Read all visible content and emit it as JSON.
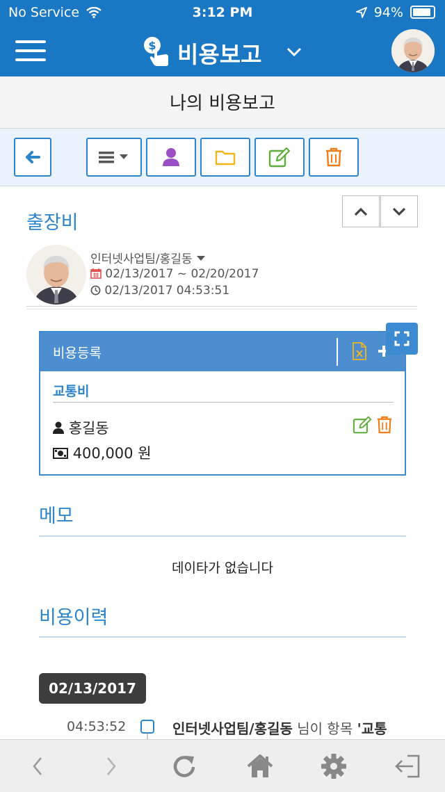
{
  "status": {
    "carrier": "No Service",
    "time": "3:12 PM",
    "battery": "94%"
  },
  "header": {
    "title": "비용보고",
    "menu_icon": "hamburger-icon",
    "app_icon": "money-hand-icon",
    "dropdown_icon": "chevron-down-icon"
  },
  "subheader": {
    "title": "나의 비용보고"
  },
  "toolbar": {
    "buttons": [
      {
        "name": "back-button",
        "icon": "arrow-left-icon"
      },
      {
        "name": "list-menu-button",
        "icon": "list-icon"
      },
      {
        "name": "user-button",
        "icon": "user-icon"
      },
      {
        "name": "folder-button",
        "icon": "folder-icon"
      },
      {
        "name": "edit-button",
        "icon": "edit-icon"
      },
      {
        "name": "delete-button",
        "icon": "trash-icon"
      }
    ]
  },
  "report": {
    "title": "출장비",
    "author": "인터넷사업팀/홍길동",
    "period": "02/13/2017 ~ 02/20/2017",
    "created": "02/13/2017 04:53:51"
  },
  "expense_card": {
    "title": "비용등록",
    "category": "교통비",
    "person": "홍길동",
    "amount": "400,000 원"
  },
  "memo": {
    "title": "메모",
    "empty_text": "데이타가 없습니다"
  },
  "history": {
    "title": "비용이력",
    "date": "02/13/2017",
    "entries": [
      {
        "time": "04:53:52",
        "actor": "인터넷사업팀/홍길동",
        "text": "님이 항목",
        "item": "'교통"
      }
    ]
  },
  "colors": {
    "primary": "#1a77c4",
    "accent_blue": "#2c84cc",
    "green": "#5cae3b",
    "orange": "#f07d1a",
    "purple": "#9b4fc4",
    "yellow": "#f2b51c"
  }
}
